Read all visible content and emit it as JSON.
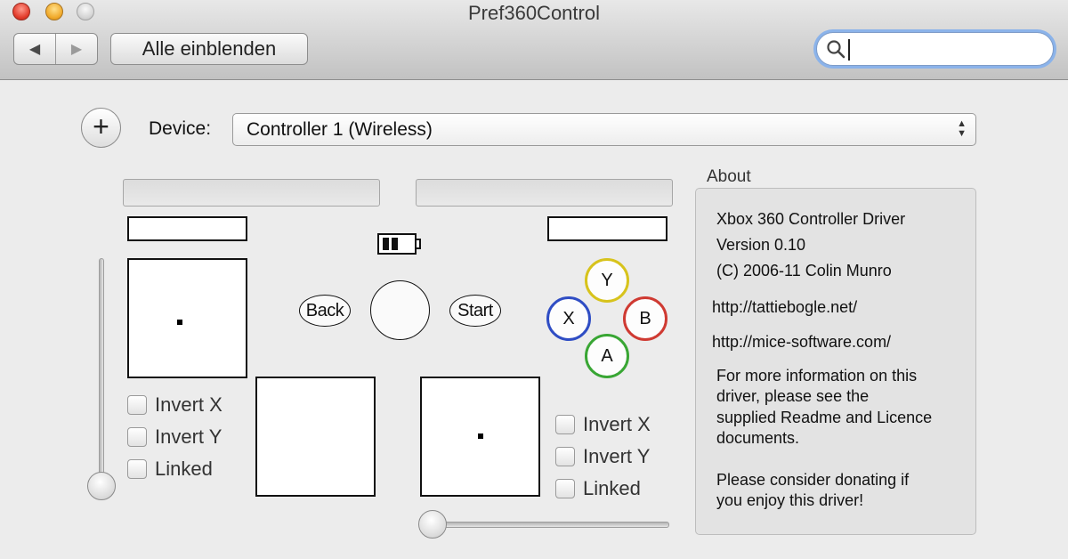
{
  "window": {
    "title": "Pref360Control"
  },
  "toolbar": {
    "back_glyph": "◀",
    "forward_glyph": "▶",
    "show_all_label": "Alle einblenden",
    "search_value": "",
    "search_placeholder": ""
  },
  "device": {
    "add_glyph": "+",
    "label": "Device:",
    "selected": "Controller 1 (Wireless)"
  },
  "controller": {
    "left_stick": {
      "invert_x": "Invert X",
      "invert_y": "Invert Y",
      "linked": "Linked"
    },
    "right_stick": {
      "invert_x": "Invert X",
      "invert_y": "Invert Y",
      "linked": "Linked"
    },
    "back_label": "Back",
    "start_label": "Start",
    "face_buttons": {
      "y": "Y",
      "x": "X",
      "b": "B",
      "a": "A"
    },
    "colors": {
      "y": "#d7c31c",
      "x": "#2f4dc4",
      "b": "#cf3a32",
      "a": "#39a634"
    }
  },
  "about": {
    "title": "About",
    "driver_name": "Xbox 360 Controller Driver",
    "version": "Version 0.10",
    "copyright": "(C) 2006-11 Colin Munro",
    "url1": "http://tattiebogle.net/",
    "url2": "http://mice-software.com/",
    "info_lines": [
      "For more information on this",
      "driver, please see the",
      "supplied Readme and Licence",
      "documents."
    ],
    "donate_lines": [
      "Please consider donating if",
      "you enjoy this driver!"
    ]
  }
}
